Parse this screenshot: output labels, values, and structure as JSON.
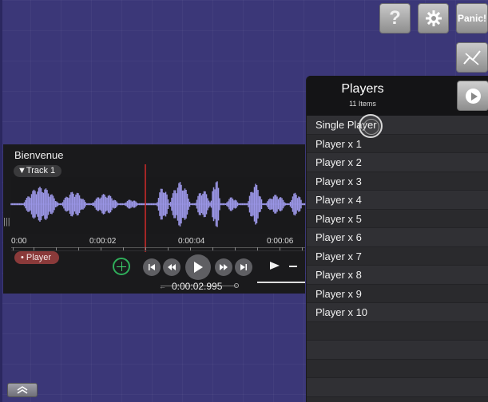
{
  "toolbar": {
    "help_label": "?",
    "panic_label": "Panic!",
    "help_icon": "question-icon",
    "settings_icon": "gear-icon",
    "tool_icon": "curve-tool-icon"
  },
  "track": {
    "title": "Bienvenue",
    "track_label": "▼Track 1",
    "player_label": "• Player",
    "time_labels": [
      "0:00",
      "0:00:02",
      "0:00:04",
      "0:00:06"
    ],
    "time_readout": "0:00:02.995",
    "left_handle": "|||"
  },
  "players_panel": {
    "title": "Players",
    "count": "11 Items",
    "items": [
      "Single Player",
      "Player x 1",
      "Player x 2",
      "Player x 3",
      "Player x 4",
      "Player x 5",
      "Player x 6",
      "Player x 7",
      "Player x 8",
      "Player x 9",
      "Player x 10"
    ]
  },
  "colors": {
    "workspace": "#3b3778",
    "waveform": "#9b96e6",
    "playhead": "#d22a2a",
    "player_pill": "#8a3a3a",
    "sync_green": "#2fae5a"
  }
}
